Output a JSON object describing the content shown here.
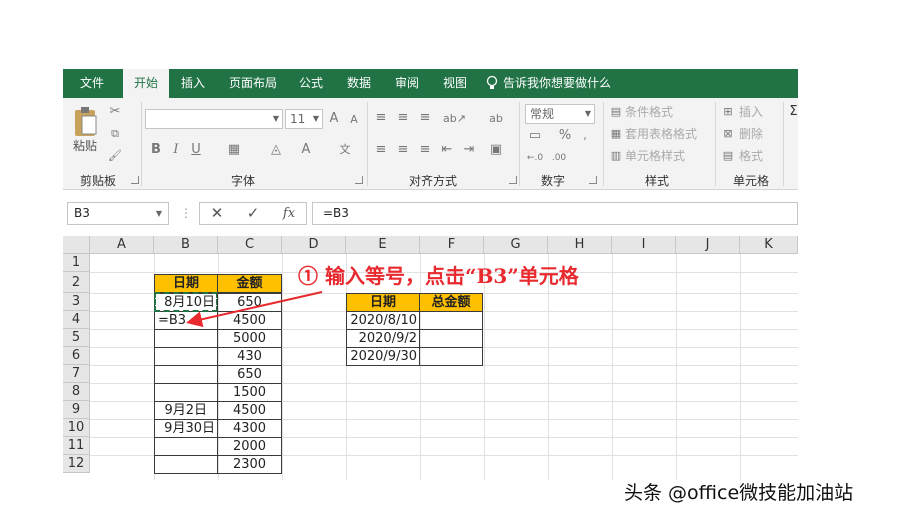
{
  "ribbon": {
    "tabs": [
      "文件",
      "开始",
      "插入",
      "页面布局",
      "公式",
      "数据",
      "审阅",
      "视图"
    ],
    "tell_me": "告诉我你想要做什么",
    "groups": {
      "clipboard": "剪贴板",
      "font": "字体",
      "alignment": "对齐方式",
      "number": "数字",
      "styles": "样式",
      "cells": "单元格"
    },
    "paste_label": "粘贴",
    "font_size": "11",
    "number_format": "常规",
    "styles_items": [
      "条件格式",
      "套用表格格式",
      "单元格样式"
    ],
    "cells_items": [
      "插入",
      "删除",
      "格式"
    ],
    "font_buttons": [
      "B",
      "I",
      "U"
    ],
    "grow_font": "A",
    "shrink_font": "A",
    "wrap_text_icon": "ab"
  },
  "formula_bar": {
    "name_box": "B3",
    "formula": "=B3",
    "fx": "fx"
  },
  "sheet": {
    "columns": [
      "A",
      "B",
      "C",
      "D",
      "E",
      "F",
      "G",
      "H",
      "I",
      "J",
      "K"
    ],
    "rows": [
      "1",
      "2",
      "3",
      "4",
      "5",
      "6",
      "7",
      "8",
      "9",
      "10",
      "11",
      "12"
    ],
    "table1": {
      "headers": [
        "日期",
        "金额"
      ],
      "dates": [
        "8月10日",
        "=B3",
        "",
        "",
        "",
        "",
        "9月2日",
        "9月30日",
        "",
        ""
      ],
      "amounts": [
        "650",
        "4500",
        "5000",
        "430",
        "650",
        "1500",
        "4500",
        "4300",
        "2000",
        "2300"
      ]
    },
    "table2": {
      "headers": [
        "日期",
        "总金额"
      ],
      "dates": [
        "2020/8/10",
        "2020/9/2",
        "2020/9/30"
      ],
      "totals": [
        "",
        "",
        ""
      ]
    }
  },
  "annotation": "① 输入等号，点击“B3”单元格",
  "watermark": "头条 @office微技能加油站",
  "colors": {
    "excel_green": "#217346",
    "header_fill": "#ffc000",
    "annotation_red": "#e8292e"
  }
}
